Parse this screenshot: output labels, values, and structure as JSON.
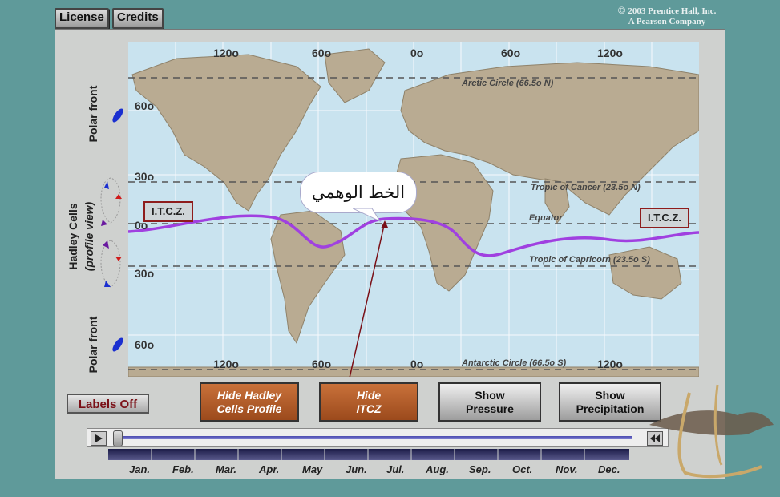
{
  "topbar": {
    "license_label": "License",
    "credits_label": "Credits",
    "copyright_line1": "2003 Prentice Hall, Inc.",
    "copyright_line2": "A Pearson Company",
    "copyright_symbol": "©"
  },
  "map": {
    "longitudes_top": [
      "120o",
      "60o",
      "0o",
      "60o",
      "120o"
    ],
    "longitudes_bottom": [
      "120o",
      "60o",
      "0o",
      "120o"
    ],
    "latitudes": [
      "60o",
      "30o",
      "0o",
      "30o",
      "60o"
    ],
    "lines": {
      "arctic": "Arctic Circle (66.5o N)",
      "cancer": "Tropic of Cancer (23.5o N)",
      "equator": "Equator",
      "capricorn": "Tropic of Capricorn (23.5o S)",
      "antarctic": "Antarctic Circle (66.5o S)"
    },
    "itcz_left": "I.T.C.Z.",
    "itcz_right": "I.T.C.Z.",
    "speech_bubble": "الخط الوهمي"
  },
  "side": {
    "polar_front_top": "Polar front",
    "polar_front_bottom": "Polar front",
    "hadley_title": "Hadley Cells",
    "hadley_sub": "(profile view)"
  },
  "controls": {
    "labels_off": "Labels Off",
    "hide_hadley_line1": "Hide Hadley",
    "hide_hadley_line2": "Cells Profile",
    "hide_itcz_line1": "Hide",
    "hide_itcz_line2": "ITCZ",
    "show_pressure_line1": "Show",
    "show_pressure_line2": "Pressure",
    "show_precip_line1": "Show",
    "show_precip_line2": "Precipitation"
  },
  "timeline": {
    "months": [
      "Jan.",
      "Feb.",
      "Mar.",
      "Apr.",
      "May",
      "Jun.",
      "Jul.",
      "Aug.",
      "Sep.",
      "Oct.",
      "Nov.",
      "Dec."
    ],
    "play_icon": "play-icon",
    "rewind_icon": "rewind-icon"
  },
  "colors": {
    "background": "#5f9a9a",
    "itcz_line": "#a040e0",
    "ocean": "#c9e3ef",
    "land": "#b9ab92"
  }
}
